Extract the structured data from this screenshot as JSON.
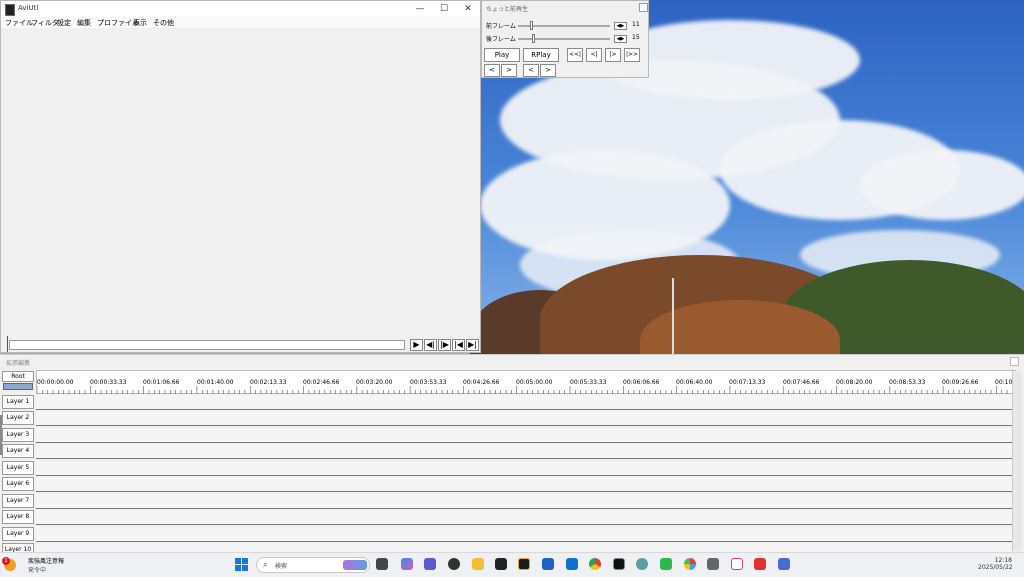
{
  "main": {
    "title": "AviUtl",
    "menu": [
      "ファイル",
      "フィルタ",
      "設定",
      "編集",
      "プロファイル",
      "表示",
      "その他"
    ],
    "window_controls": {
      "minimize": "—",
      "maximize": "☐",
      "close": "✕"
    },
    "playback_buttons": [
      "▶",
      "◀|",
      "|▶",
      "|◀",
      "▶|"
    ]
  },
  "choppy": {
    "title": "ちょっと前再生",
    "front_label": "前フレーム",
    "front_value": "11",
    "back_label": "後フレーム",
    "back_value": "15",
    "play": "Play",
    "rplay": "RPlay",
    "nav_buttons": [
      "<<|",
      "<|",
      "|>",
      "|>>"
    ],
    "arrow_buttons": [
      "<",
      ">",
      "<",
      ">"
    ]
  },
  "timeline": {
    "title": "拡張編集",
    "root": "Root",
    "ticks": [
      "00:00:00.00",
      "00:00:33.33",
      "00:01:06.66",
      "00:01:40.00",
      "00:02:13.33",
      "00:02:46.66",
      "00:03:20.00",
      "00:03:53.33",
      "00:04:26.66",
      "00:05:00.00",
      "00:05:33.33",
      "00:06:06.66",
      "00:06:40.00",
      "00:07:13.33",
      "00:07:46.66",
      "00:08:20.00",
      "00:08:53.33",
      "00:09:26.66",
      "00:10"
    ],
    "layers": [
      "Layer 1",
      "Layer 2",
      "Layer 3",
      "Layer 4",
      "Layer 5",
      "Layer 6",
      "Layer 7",
      "Layer 8",
      "Layer 9",
      "Layer 10"
    ]
  },
  "taskbar": {
    "weather_title": "疾強風注意報",
    "weather_sub": "発令中",
    "weather_badge": "1",
    "search_placeholder": "検索",
    "time": "12:18",
    "date": "2025/05/22"
  }
}
